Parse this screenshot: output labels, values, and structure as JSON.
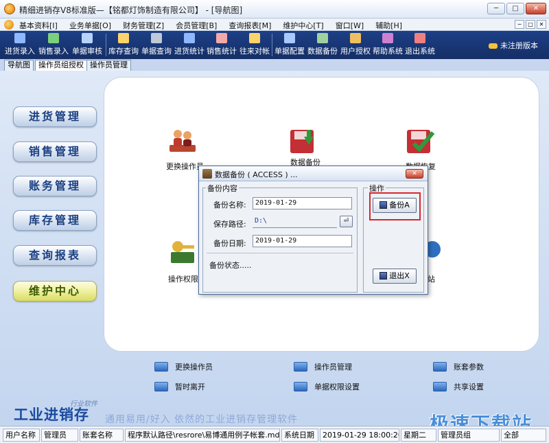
{
  "window": {
    "title": "精细进销存V8标准版—【铭都灯饰制造有限公司】 - [导航图]",
    "min": "─",
    "max": "□",
    "close": "✕"
  },
  "menu": {
    "items": [
      "基本资料[I]",
      "业务单据[O]",
      "财务管理[Z]",
      "会员管理[B]",
      "查询报表[M]",
      "维护中心[T]",
      "窗口[W]",
      "辅助[H]"
    ],
    "mdi_min": "─",
    "mdi_max": "□",
    "mdi_close": "✕"
  },
  "toolbar": {
    "items": [
      {
        "label": "进货录入",
        "color": "#8fb8ff"
      },
      {
        "label": "销售录入",
        "color": "#7cd07c"
      },
      {
        "label": "单据审核",
        "color": "#b9d3ff"
      },
      {
        "label": "库存查询",
        "color": "#ffd36b"
      },
      {
        "label": "单据查询",
        "color": "#c0c8d8"
      },
      {
        "label": "进货统计",
        "color": "#8fb8ff"
      },
      {
        "label": "销售统计",
        "color": "#f4a8a8"
      },
      {
        "label": "往来对帐",
        "color": "#ffd36b"
      },
      {
        "label": "单据配置",
        "color": "#a8c8ff"
      },
      {
        "label": "数据备份",
        "color": "#a0d0a0"
      },
      {
        "label": "用户授权",
        "color": "#f0c060"
      },
      {
        "label": "帮助系统",
        "color": "#d080d0"
      },
      {
        "label": "退出系统",
        "color": "#f08080"
      }
    ],
    "register": "未注册版本"
  },
  "tabs": [
    "导航图",
    "操作员组授权",
    "操作员管理"
  ],
  "sidebar": [
    "进货管理",
    "销售管理",
    "账务管理",
    "库存管理",
    "查询报表",
    "维护中心"
  ],
  "main": {
    "icons": {
      "change_operator": "更换操作员",
      "data_backup": "数据备份",
      "data_restore": "数据恢复",
      "permission": "操作权限",
      "site": "站"
    },
    "links": [
      "更换操作员",
      "操作员管理",
      "账套参数",
      "暂时离开",
      "单据权限设置",
      "共享设置"
    ]
  },
  "brand": {
    "name": "工业进销存",
    "sub": "行业软件",
    "slogan": "通用易用/好入 依然的工业进销存管理软件"
  },
  "dialog": {
    "title": "数据备份 ( ACCESS ) ...",
    "close": "✕",
    "content_group": "备份内容",
    "name_label": "备份名称:",
    "name_value": "2019-01-29",
    "path_label": "保存路径:",
    "path_value": "D:\\",
    "date_label": "备份日期:",
    "date_value": "2019-01-29",
    "status_label": "备份状态.....",
    "action_group": "操作",
    "backup_button": "备份A",
    "exit_button": "退出X"
  },
  "statusbar": {
    "user_label": "用户名称",
    "user_value": "管理员",
    "set_label": "账套名称",
    "set_value": "程序默认路径\\resrore\\易博通用例子帐套.mdb",
    "date_label": "系统日期",
    "date_value": "2019-01-29  18:00:20",
    "weekday": "星期二",
    "group_value": "管理员组",
    "scope_value": "全部"
  },
  "watermark": "极速下载站"
}
